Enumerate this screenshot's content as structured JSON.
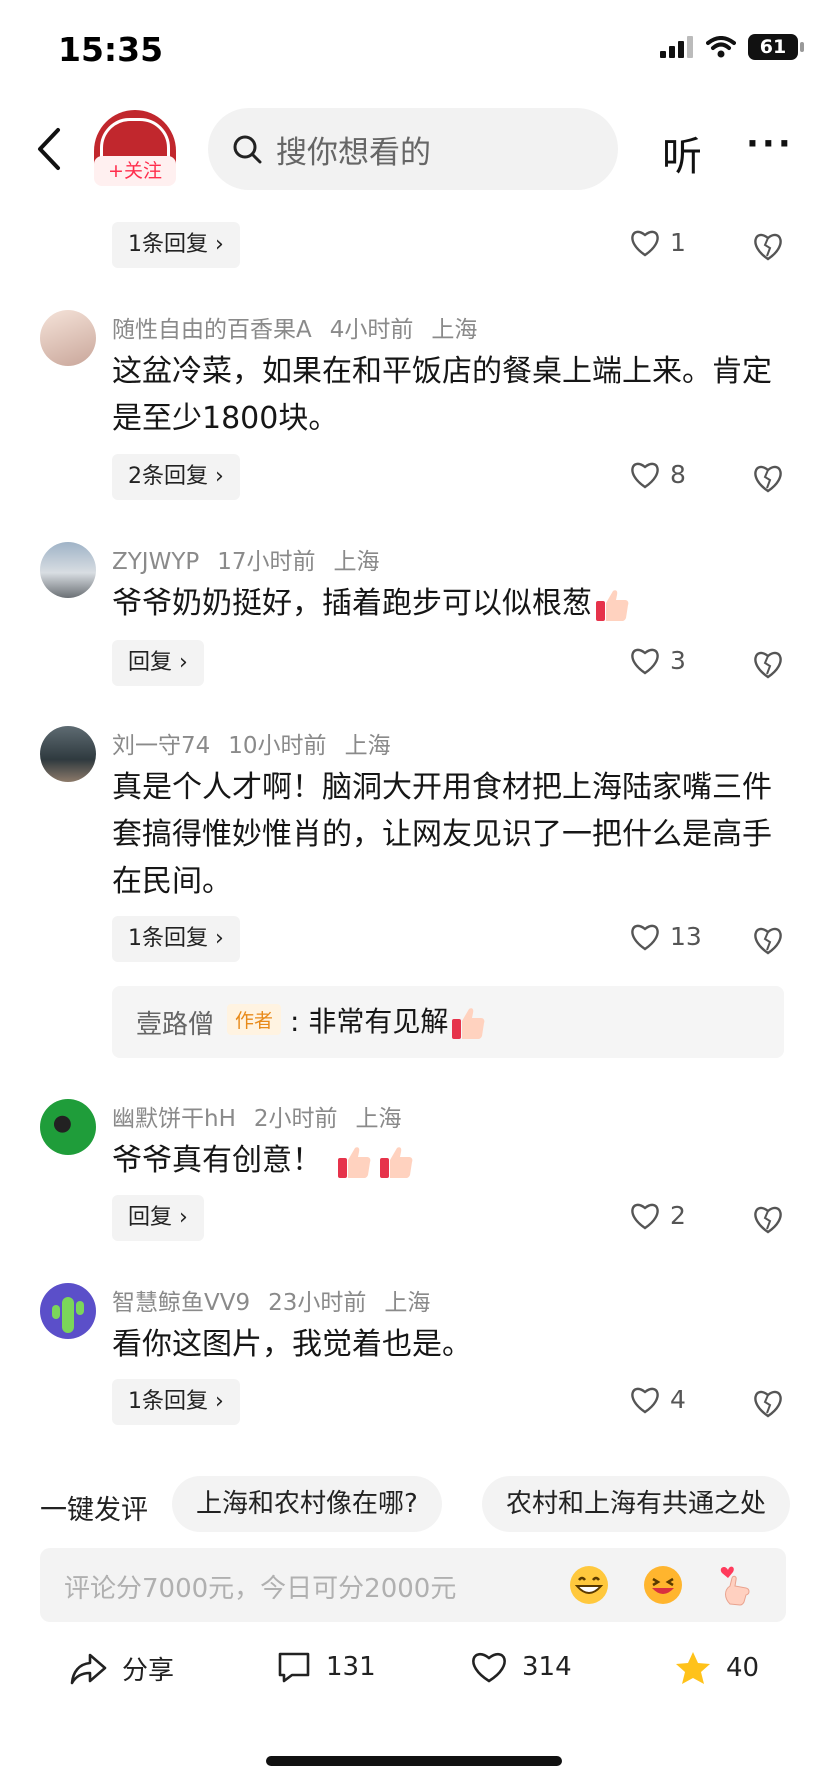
{
  "status_bar": {
    "time": "15:35",
    "battery": "61"
  },
  "header": {
    "follow_label": "+关注",
    "search_placeholder": "搜你想看的",
    "listen_label": "听",
    "more_label": "···"
  },
  "comments": [
    {
      "reply_label": "1条回复",
      "likes": "1"
    },
    {
      "user": "随性自由的百香果A",
      "time": "4小时前",
      "location": "上海",
      "text": "这盆冷菜，如果在和平饭店的餐桌上端上来。肯定是至少1800块。",
      "reply_label": "2条回复",
      "likes": "8"
    },
    {
      "user": "ZYJWYP",
      "time": "17小时前",
      "location": "上海",
      "text": "爷爷奶奶挺好，插着跑步可以似根葱",
      "reply_label": "回复",
      "likes": "3"
    },
    {
      "user": "刘一守74",
      "time": "10小时前",
      "location": "上海",
      "text": "真是个人才啊！脑洞大开用食材把上海陆家嘴三件套搞得惟妙惟肖的，让网友见识了一把什么是高手在民间。",
      "reply_label": "1条回复",
      "likes": "13"
    },
    {
      "user": "幽默饼干hH",
      "time": "2小时前",
      "location": "上海",
      "text": "爷爷真有创意！",
      "reply_label": "回复",
      "likes": "2"
    },
    {
      "user": "智慧鲸鱼VV9",
      "time": "23小时前",
      "location": "上海",
      "text": "看你这图片，我觉着也是。",
      "reply_label": "1条回复",
      "likes": "4"
    }
  ],
  "author_reply": {
    "name": "壹路僧",
    "tag": "作者",
    "text": ": 非常有见解"
  },
  "quick_comment": {
    "label": "一键发评",
    "chips": [
      "上海和农村像在哪?",
      "农村和上海有共通之处"
    ]
  },
  "input": {
    "placeholder": "评论分7000元，今日可分2000元"
  },
  "bottom_bar": {
    "share_label": "分享",
    "comments_count": "131",
    "likes_count": "314",
    "favorites_count": "40"
  },
  "colors": {
    "accent": "#ff2e4d",
    "star": "#ffc21a",
    "seal": "#c1272d"
  }
}
